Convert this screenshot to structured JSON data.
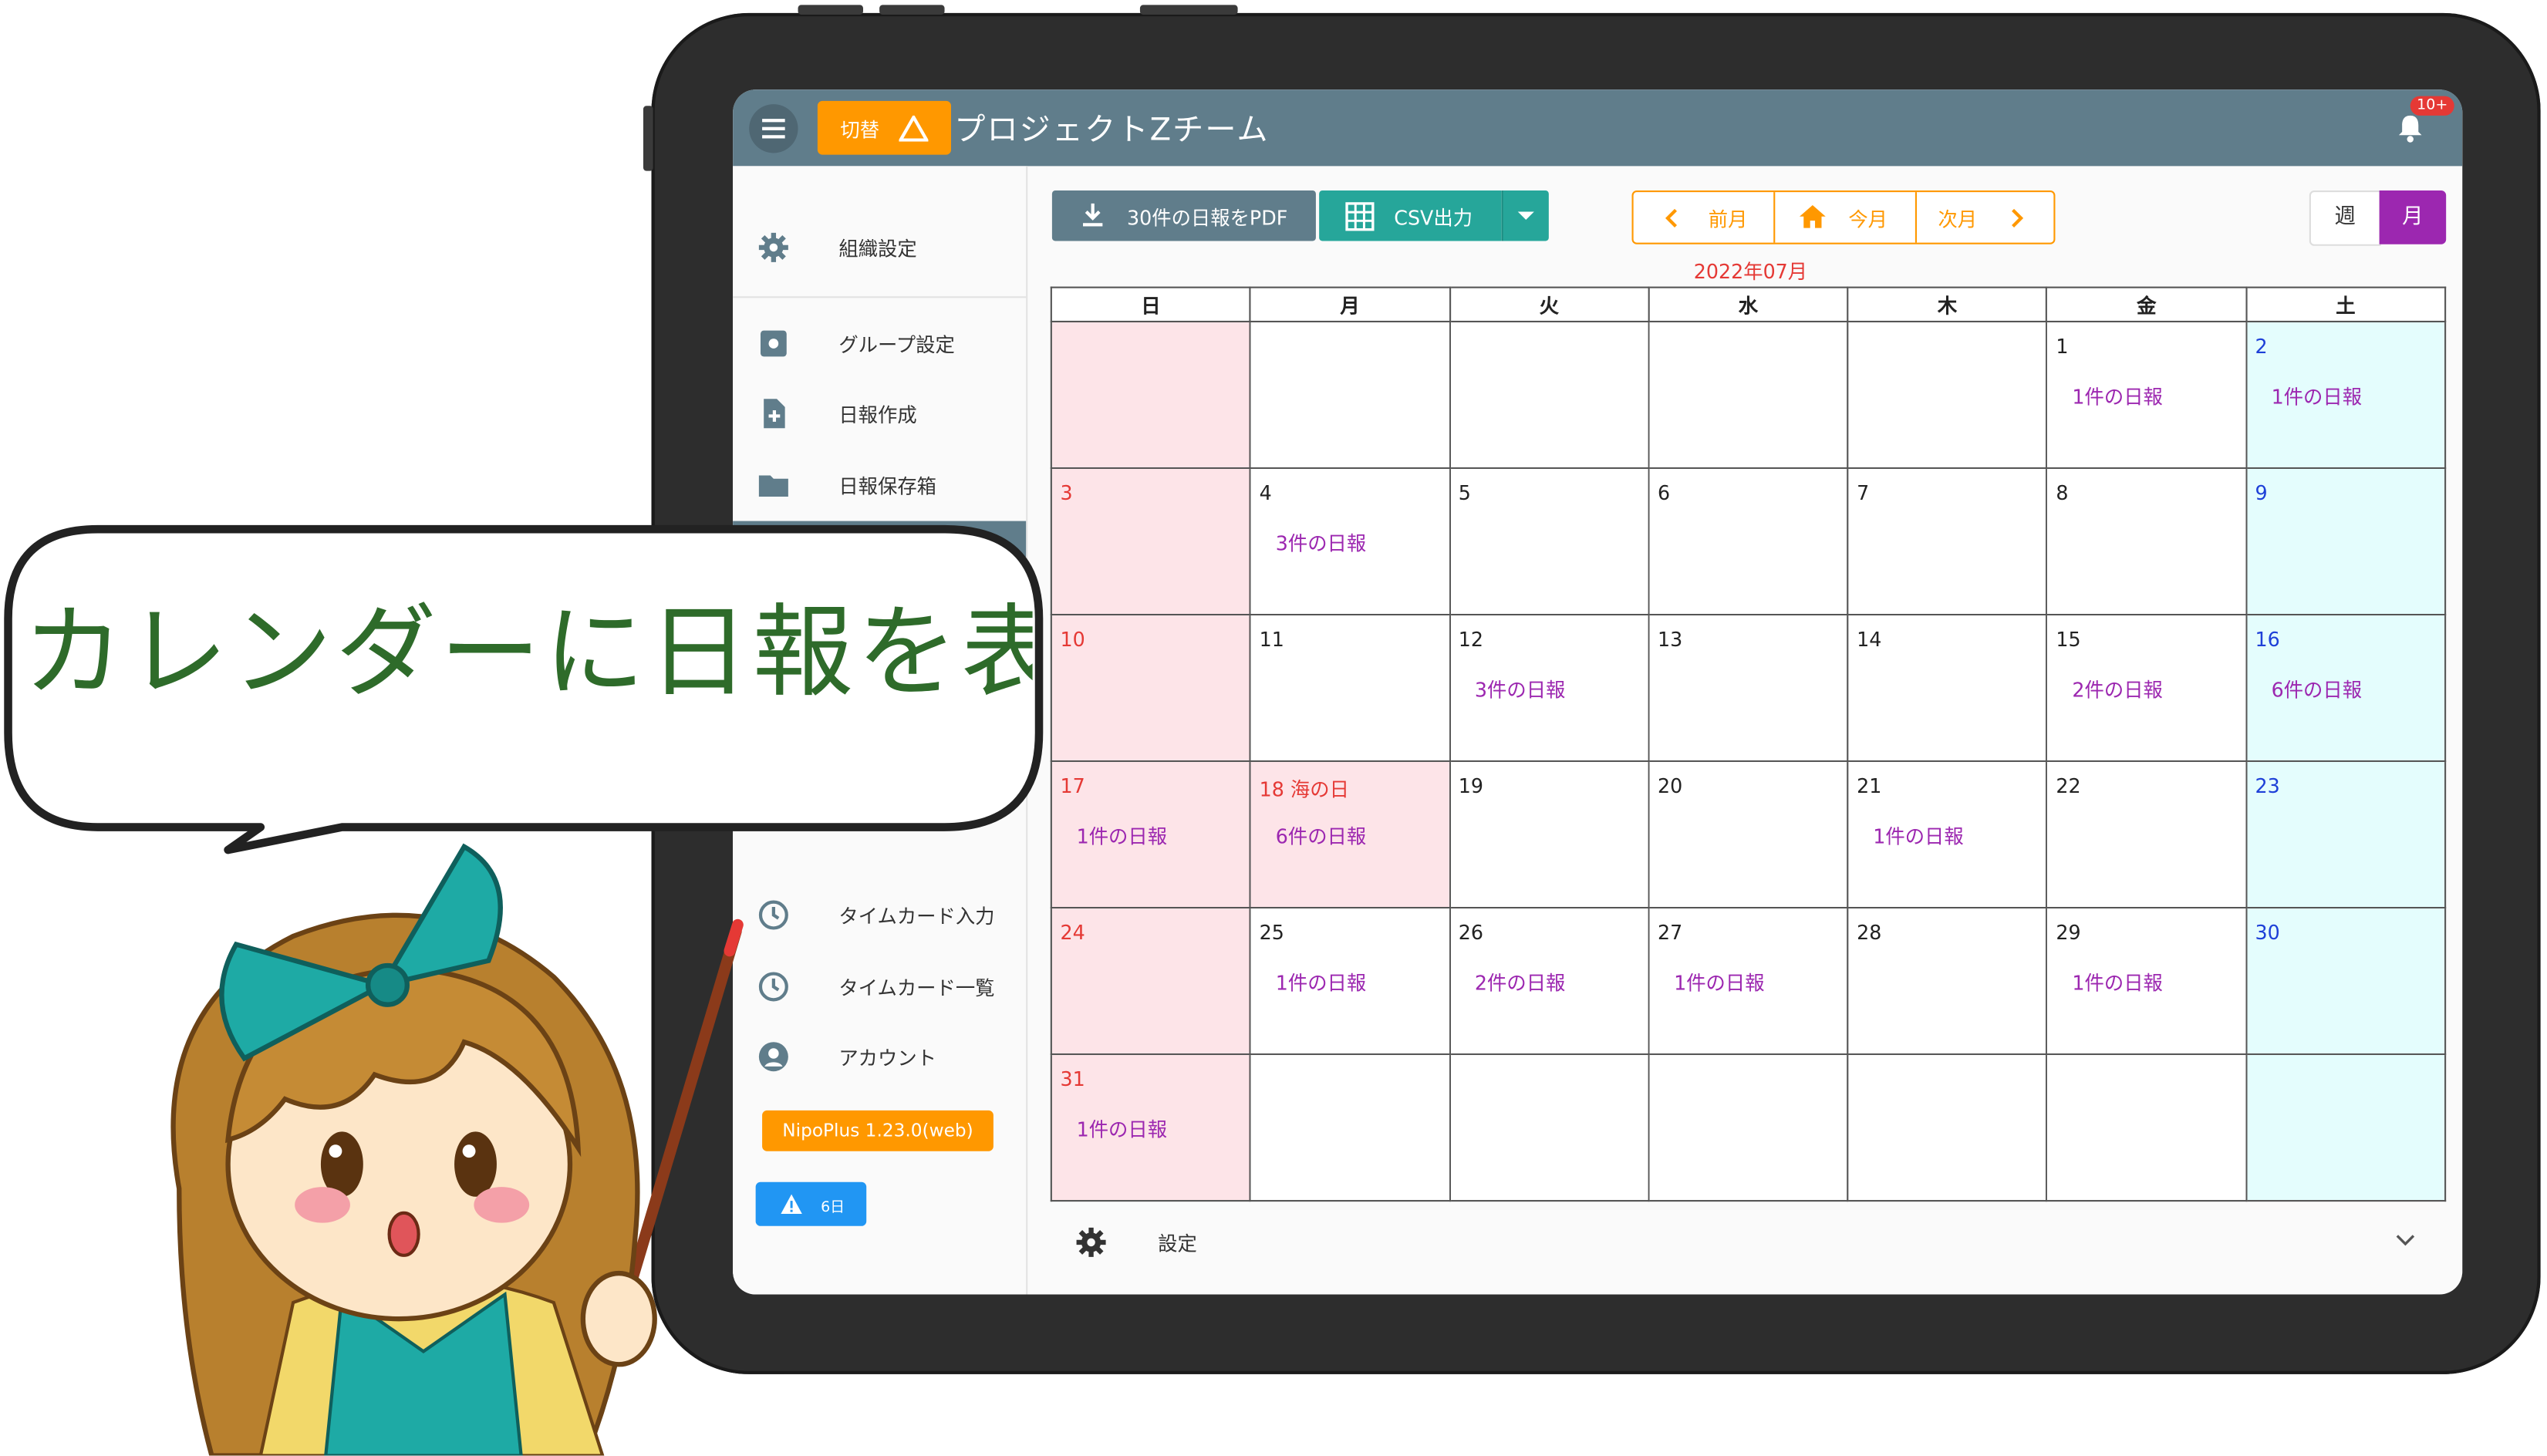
{
  "app": {
    "switch_label": "切替",
    "title": "プロジェクトZチーム",
    "notification_badge": "10+"
  },
  "sidebar": {
    "items": [
      {
        "label": "組織設定",
        "icon": "gear-icon"
      },
      {
        "label": "グループ設定",
        "icon": "cog-box-icon"
      },
      {
        "label": "日報作成",
        "icon": "file-plus-icon"
      },
      {
        "label": "日報保存箱",
        "icon": "folder-icon"
      },
      {
        "label": "タイムカード入力",
        "icon": "clock-icon"
      },
      {
        "label": "タイムカード一覧",
        "icon": "clock-icon"
      },
      {
        "label": "アカウント",
        "icon": "account-icon"
      }
    ],
    "version": "NipoPlus 1.23.0(web)",
    "warning_days": "6日"
  },
  "toolbar": {
    "pdf_label": "30件の日報をPDF",
    "csv_label": "CSV出力",
    "prev_month": "前月",
    "this_month": "今月",
    "next_month": "次月",
    "week": "週",
    "month": "月"
  },
  "calendar": {
    "year_month": "2022年07月",
    "weekdays": [
      "日",
      "月",
      "火",
      "水",
      "木",
      "金",
      "土"
    ],
    "weeks": [
      [
        {
          "d": "",
          "r": ""
        },
        {
          "d": "",
          "r": ""
        },
        {
          "d": "",
          "r": ""
        },
        {
          "d": "",
          "r": ""
        },
        {
          "d": "",
          "r": ""
        },
        {
          "d": "1",
          "r": "1件の日報"
        },
        {
          "d": "2",
          "r": "1件の日報"
        }
      ],
      [
        {
          "d": "3",
          "r": ""
        },
        {
          "d": "4",
          "r": "3件の日報"
        },
        {
          "d": "5",
          "r": ""
        },
        {
          "d": "6",
          "r": ""
        },
        {
          "d": "7",
          "r": ""
        },
        {
          "d": "8",
          "r": ""
        },
        {
          "d": "9",
          "r": ""
        }
      ],
      [
        {
          "d": "10",
          "r": ""
        },
        {
          "d": "11",
          "r": ""
        },
        {
          "d": "12",
          "r": "3件の日報"
        },
        {
          "d": "13",
          "r": ""
        },
        {
          "d": "14",
          "r": ""
        },
        {
          "d": "15",
          "r": "2件の日報"
        },
        {
          "d": "16",
          "r": "6件の日報"
        }
      ],
      [
        {
          "d": "17",
          "r": "1件の日報"
        },
        {
          "d": "18 海の日",
          "r": "6件の日報"
        },
        {
          "d": "19",
          "r": ""
        },
        {
          "d": "20",
          "r": ""
        },
        {
          "d": "21",
          "r": "1件の日報"
        },
        {
          "d": "22",
          "r": ""
        },
        {
          "d": "23",
          "r": ""
        }
      ],
      [
        {
          "d": "24",
          "r": ""
        },
        {
          "d": "25",
          "r": "1件の日報"
        },
        {
          "d": "26",
          "r": "2件の日報"
        },
        {
          "d": "27",
          "r": "1件の日報"
        },
        {
          "d": "28",
          "r": ""
        },
        {
          "d": "29",
          "r": "1件の日報"
        },
        {
          "d": "30",
          "r": ""
        }
      ],
      [
        {
          "d": "31",
          "r": "1件の日報"
        },
        {
          "d": "",
          "r": ""
        },
        {
          "d": "",
          "r": ""
        },
        {
          "d": "",
          "r": ""
        },
        {
          "d": "",
          "r": ""
        },
        {
          "d": "",
          "r": ""
        },
        {
          "d": "",
          "r": ""
        }
      ]
    ],
    "holidays": [
      "18 海の日"
    ]
  },
  "settings": {
    "label": "設定"
  },
  "callout": {
    "text": "カレンダーに日報を表示"
  },
  "colors": {
    "appbar": "#607d8b",
    "accent_orange": "#ff9800",
    "csv_teal": "#26a69a",
    "month_purple": "#9c27b0",
    "sunday_bg": "#fde4e8",
    "saturday_bg": "#e4fdfd"
  }
}
